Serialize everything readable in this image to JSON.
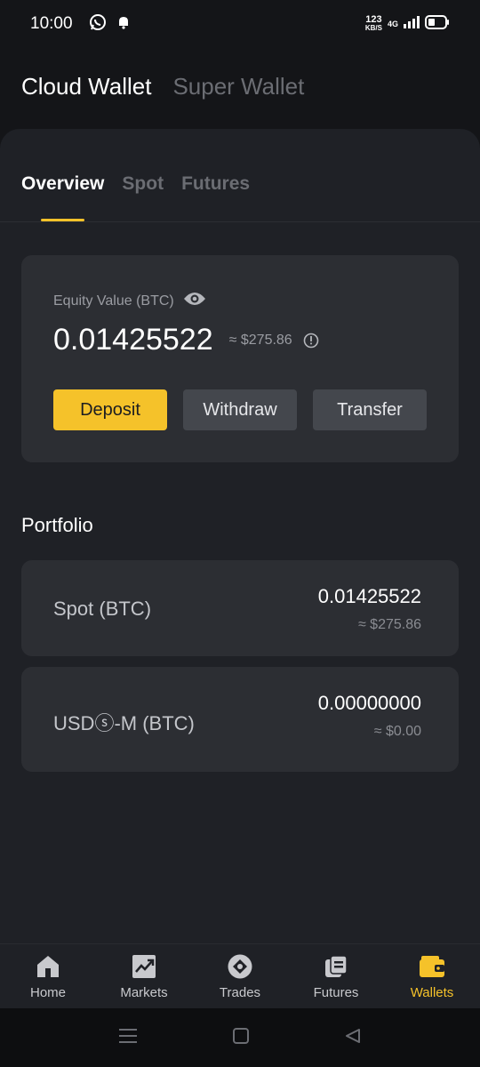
{
  "status_bar": {
    "time": "10:00",
    "net_speed_value": "123",
    "net_speed_unit": "KB/S",
    "network": "4G"
  },
  "top_tabs": [
    {
      "label": "Cloud Wallet",
      "active": true
    },
    {
      "label": "Super Wallet",
      "active": false
    }
  ],
  "sub_tabs": [
    {
      "label": "Overview",
      "active": true
    },
    {
      "label": "Spot",
      "active": false
    },
    {
      "label": "Futures",
      "active": false
    }
  ],
  "equity": {
    "label": "Equity Value (BTC)",
    "value": "0.01425522",
    "usd": "≈ $275.86"
  },
  "actions": {
    "deposit": "Deposit",
    "withdraw": "Withdraw",
    "transfer": "Transfer"
  },
  "portfolio": {
    "title": "Portfolio",
    "assets": [
      {
        "name": "Spot (BTC)",
        "amount": "0.01425522",
        "usd": "≈ $275.86"
      },
      {
        "name": "USDⓢ-M (BTC)",
        "amount": "0.00000000",
        "usd": "≈ $0.00"
      }
    ]
  },
  "bottom_nav": [
    {
      "label": "Home",
      "icon": "home-icon",
      "active": false
    },
    {
      "label": "Markets",
      "icon": "markets-icon",
      "active": false
    },
    {
      "label": "Trades",
      "icon": "trades-icon",
      "active": false
    },
    {
      "label": "Futures",
      "icon": "futures-icon",
      "active": false
    },
    {
      "label": "Wallets",
      "icon": "wallet-icon",
      "active": true
    }
  ],
  "colors": {
    "accent": "#f5c22a",
    "background": "#141518",
    "panel": "#1f2126",
    "card": "#2c2e33"
  }
}
